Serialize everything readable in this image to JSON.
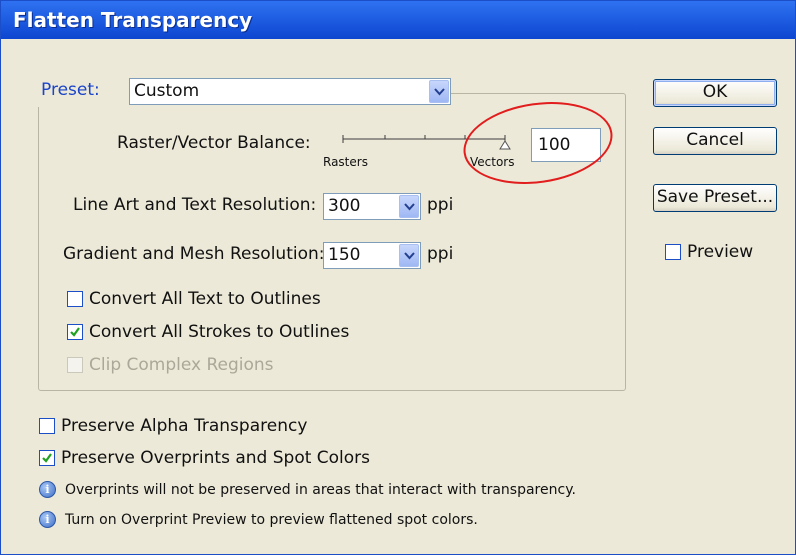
{
  "window": {
    "title": "Flatten Transparency"
  },
  "preset": {
    "label": "Preset:",
    "value": "Custom"
  },
  "balance": {
    "label": "Raster/Vector Balance:",
    "rasters_label": "Rasters",
    "vectors_label": "Vectors",
    "value": "100"
  },
  "line_art": {
    "label": "Line Art and Text Resolution:",
    "value": "300",
    "unit": "ppi"
  },
  "gradient": {
    "label": "Gradient and Mesh Resolution:",
    "value": "150",
    "unit": "ppi"
  },
  "options": {
    "convert_text": {
      "label": "Convert All Text to Outlines",
      "checked": false
    },
    "convert_strokes": {
      "label": "Convert All Strokes to Outlines",
      "checked": true
    },
    "clip_complex": {
      "label": "Clip Complex Regions",
      "checked": false,
      "enabled": false
    }
  },
  "preserve": {
    "alpha": {
      "label": "Preserve Alpha Transparency",
      "checked": false
    },
    "overprints": {
      "label": "Preserve Overprints and Spot Colors",
      "checked": true
    }
  },
  "info": [
    "Overprints will not be preserved in areas that interact with transparency.",
    "Turn on Overprint Preview to preview flattened spot colors."
  ],
  "buttons": {
    "ok": "OK",
    "cancel": "Cancel",
    "save_preset": "Save Preset..."
  },
  "preview": {
    "label": "Preview",
    "checked": false
  },
  "colors": {
    "title_bar": "#1f5ee3",
    "face": "#ece9d8",
    "legend_text": "#1a44c9",
    "annotation": "#e11d1d"
  }
}
